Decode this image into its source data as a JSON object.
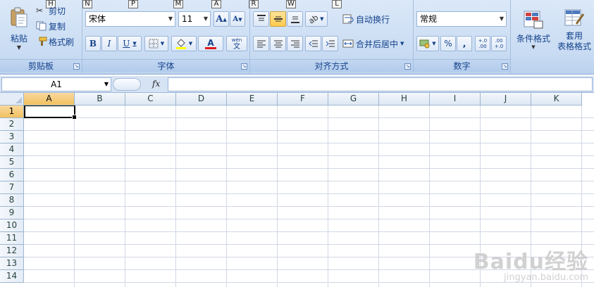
{
  "keytips": [
    "H",
    "N",
    "P",
    "M",
    "A",
    "R",
    "W",
    "L"
  ],
  "clipboard": {
    "paste_label": "粘贴",
    "cut_label": "剪切",
    "copy_label": "复制",
    "format_painter_label": "格式刷",
    "group_label": "剪贴板"
  },
  "font": {
    "font_name": "宋体",
    "font_size": "11",
    "bold": "B",
    "italic": "I",
    "underline": "U",
    "grow": "A",
    "shrink": "A",
    "font_color_glyph": "A",
    "phonetic_top": "wén",
    "phonetic_bottom": "文",
    "group_label": "字体",
    "font_color": "#e01b1b",
    "fill_color": "#ffff00"
  },
  "alignment": {
    "wrap_text_label": "自动换行",
    "merge_center_label": "合并后居中",
    "group_label": "对齐方式"
  },
  "number": {
    "format_value": "常规",
    "percent": "%",
    "comma": ",",
    "increase_decimal": "+.0 .00",
    "decrease_decimal": ".00 +.0",
    "group_label": "数字"
  },
  "styles": {
    "conditional_format_label": "条件格式",
    "table_format_label_1": "套用",
    "table_format_label_2": "表格格式"
  },
  "formula_bar": {
    "name_box": "A1",
    "fx": "fx",
    "formula": ""
  },
  "grid": {
    "columns": [
      "A",
      "B",
      "C",
      "D",
      "E",
      "F",
      "G",
      "H",
      "I",
      "J",
      "K"
    ],
    "rows": [
      "1",
      "2",
      "3",
      "4",
      "5",
      "6",
      "7",
      "8",
      "9",
      "10",
      "11",
      "12",
      "13",
      "14"
    ],
    "selected_column": "A",
    "selected_row": "1"
  },
  "watermark": {
    "main": "Baidu经验",
    "sub": "jingyan.baidu.com"
  }
}
